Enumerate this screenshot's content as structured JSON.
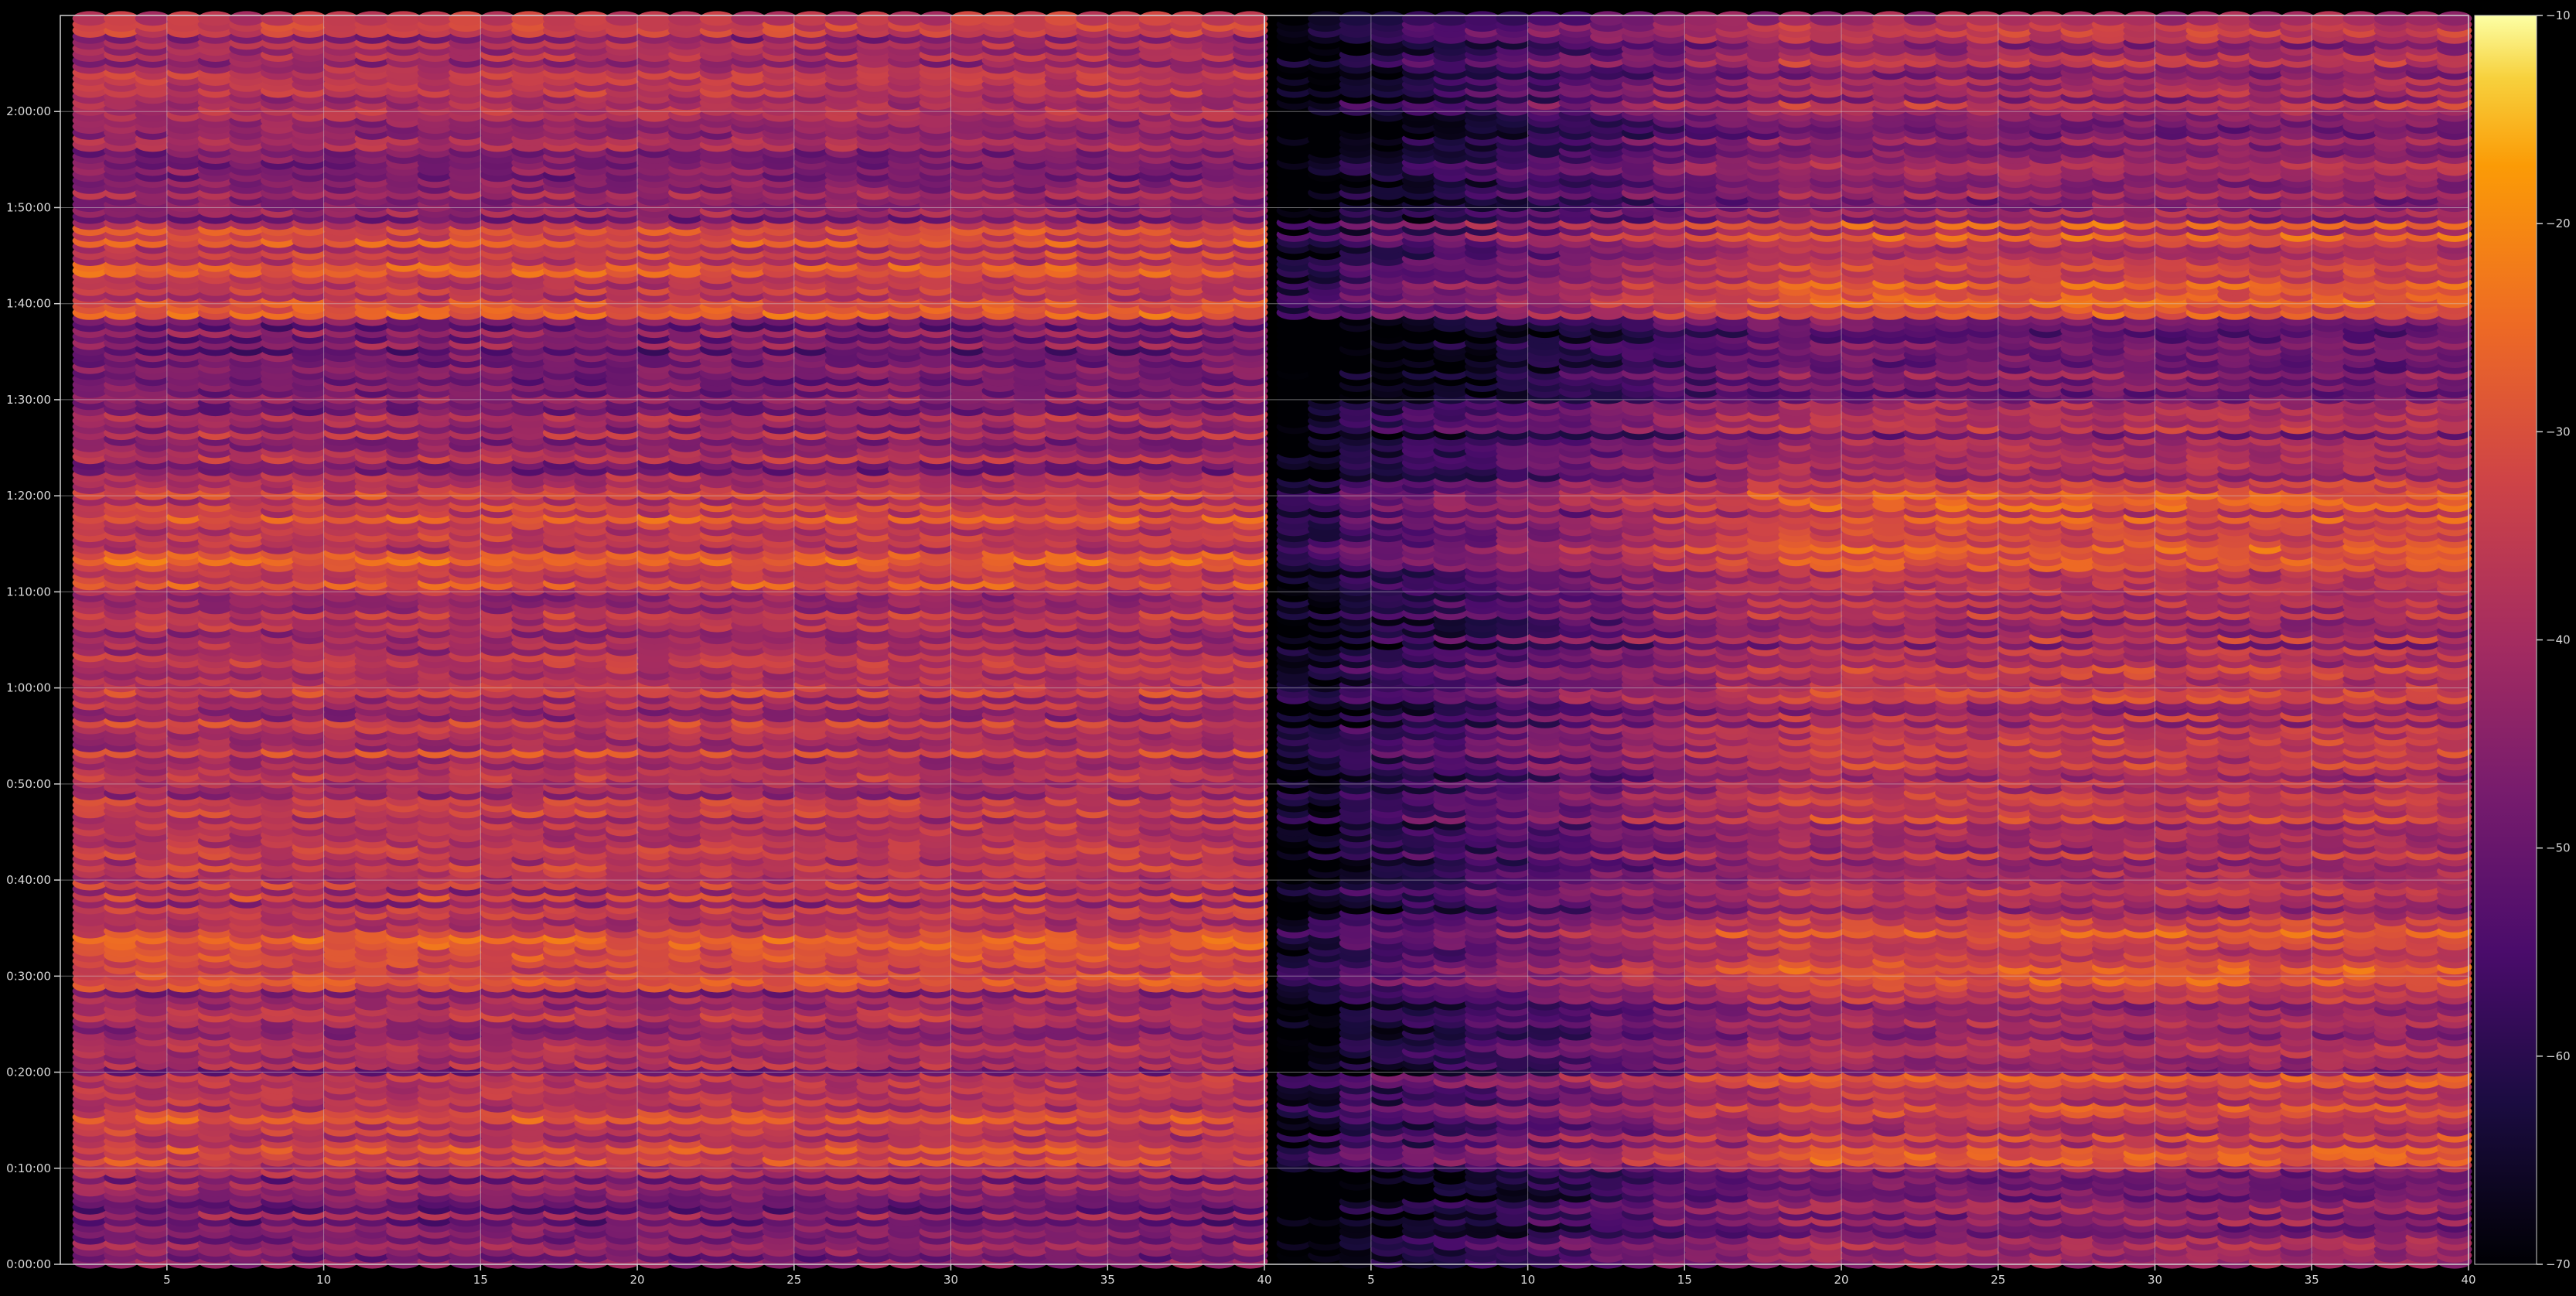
{
  "chart_data": {
    "type": "heatmap",
    "title": "",
    "xlabel": "",
    "ylabel": "",
    "colormap": "inferno",
    "background": "#000000",
    "grid": true,
    "panels": [
      {
        "name": "",
        "x_range": [
          1.6,
          40
        ],
        "x_ticks": [
          5,
          10,
          15,
          20,
          25,
          30,
          35,
          40
        ],
        "band": "full"
      },
      {
        "name": "",
        "x_range": [
          1.6,
          40
        ],
        "x_ticks": [
          5,
          10,
          15,
          20,
          25,
          30,
          35,
          40
        ],
        "band": "faded"
      }
    ],
    "x_tick_labels": [
      "5",
      "10",
      "15",
      "20",
      "25",
      "30",
      "35",
      "40"
    ],
    "y_range_seconds": [
      0,
      7800
    ],
    "y_ticks_seconds": [
      0,
      600,
      1200,
      1800,
      2400,
      3000,
      3600,
      4200,
      4800,
      5400,
      6000,
      6600,
      7200
    ],
    "y_tick_labels": [
      "0:00:00",
      "0:10:00",
      "0:20:00",
      "0:30:00",
      "0:40:00",
      "0:50:00",
      "1:00:00",
      "1:10:00",
      "1:20:00",
      "1:30:00",
      "1:40:00",
      "1:50:00",
      "2:00:00"
    ],
    "colorbar": {
      "min": -70,
      "max": -10,
      "ticks": [
        -10,
        -20,
        -30,
        -40,
        -50,
        -60,
        -70
      ],
      "tick_labels": [
        "−10",
        "−20",
        "−30",
        "−40",
        "−50",
        "−60",
        "−70"
      ]
    },
    "time_bands_level_db": [
      {
        "from_s": 0,
        "to_s": 600,
        "level_db": -46
      },
      {
        "from_s": 600,
        "to_s": 1200,
        "level_db": -34
      },
      {
        "from_s": 1200,
        "to_s": 1700,
        "level_db": -42
      },
      {
        "from_s": 1700,
        "to_s": 2100,
        "level_db": -30
      },
      {
        "from_s": 2100,
        "to_s": 2700,
        "level_db": -38
      },
      {
        "from_s": 2700,
        "to_s": 3300,
        "level_db": -36
      },
      {
        "from_s": 3300,
        "to_s": 3800,
        "level_db": -38
      },
      {
        "from_s": 3800,
        "to_s": 4200,
        "level_db": -40
      },
      {
        "from_s": 4200,
        "to_s": 4900,
        "level_db": -32
      },
      {
        "from_s": 4900,
        "to_s": 5400,
        "level_db": -42
      },
      {
        "from_s": 5400,
        "to_s": 5900,
        "level_db": -48
      },
      {
        "from_s": 5900,
        "to_s": 6500,
        "level_db": -32
      },
      {
        "from_s": 6500,
        "to_s": 7100,
        "level_db": -44
      },
      {
        "from_s": 7100,
        "to_s": 7800,
        "level_db": -40
      }
    ]
  }
}
